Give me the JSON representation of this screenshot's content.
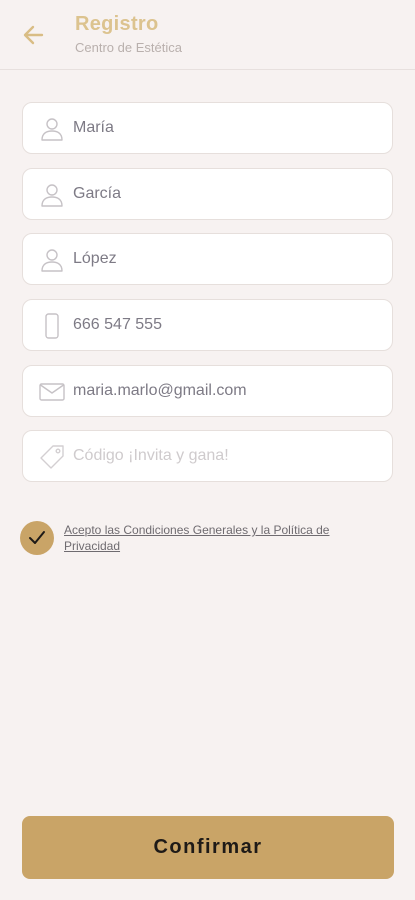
{
  "header": {
    "title": "Registro",
    "subtitle": "Centro de Estética",
    "back_icon": "arrow-left-icon"
  },
  "form": {
    "fields": [
      {
        "name": "first-name",
        "icon": "person-icon",
        "value": "María",
        "placeholder": ""
      },
      {
        "name": "last-name-1",
        "icon": "person-icon",
        "value": "García",
        "placeholder": ""
      },
      {
        "name": "last-name-2",
        "icon": "person-icon",
        "value": "López",
        "placeholder": ""
      },
      {
        "name": "phone",
        "icon": "phone-icon",
        "value": "666 547 555",
        "placeholder": ""
      },
      {
        "name": "email",
        "icon": "mail-icon",
        "value": "maria.marlo@gmail.com",
        "placeholder": ""
      },
      {
        "name": "promo-code",
        "icon": "tag-icon",
        "value": "",
        "placeholder": "Código ¡Invita y gana!"
      }
    ]
  },
  "terms": {
    "checked": true,
    "label": "Acepto las Condiciones Generales y la Política de Privacidad"
  },
  "actions": {
    "confirm_label": "Confirmar"
  },
  "colors": {
    "accent": "#c9a467",
    "title": "#dcc38f",
    "background": "#f7f2f1"
  }
}
